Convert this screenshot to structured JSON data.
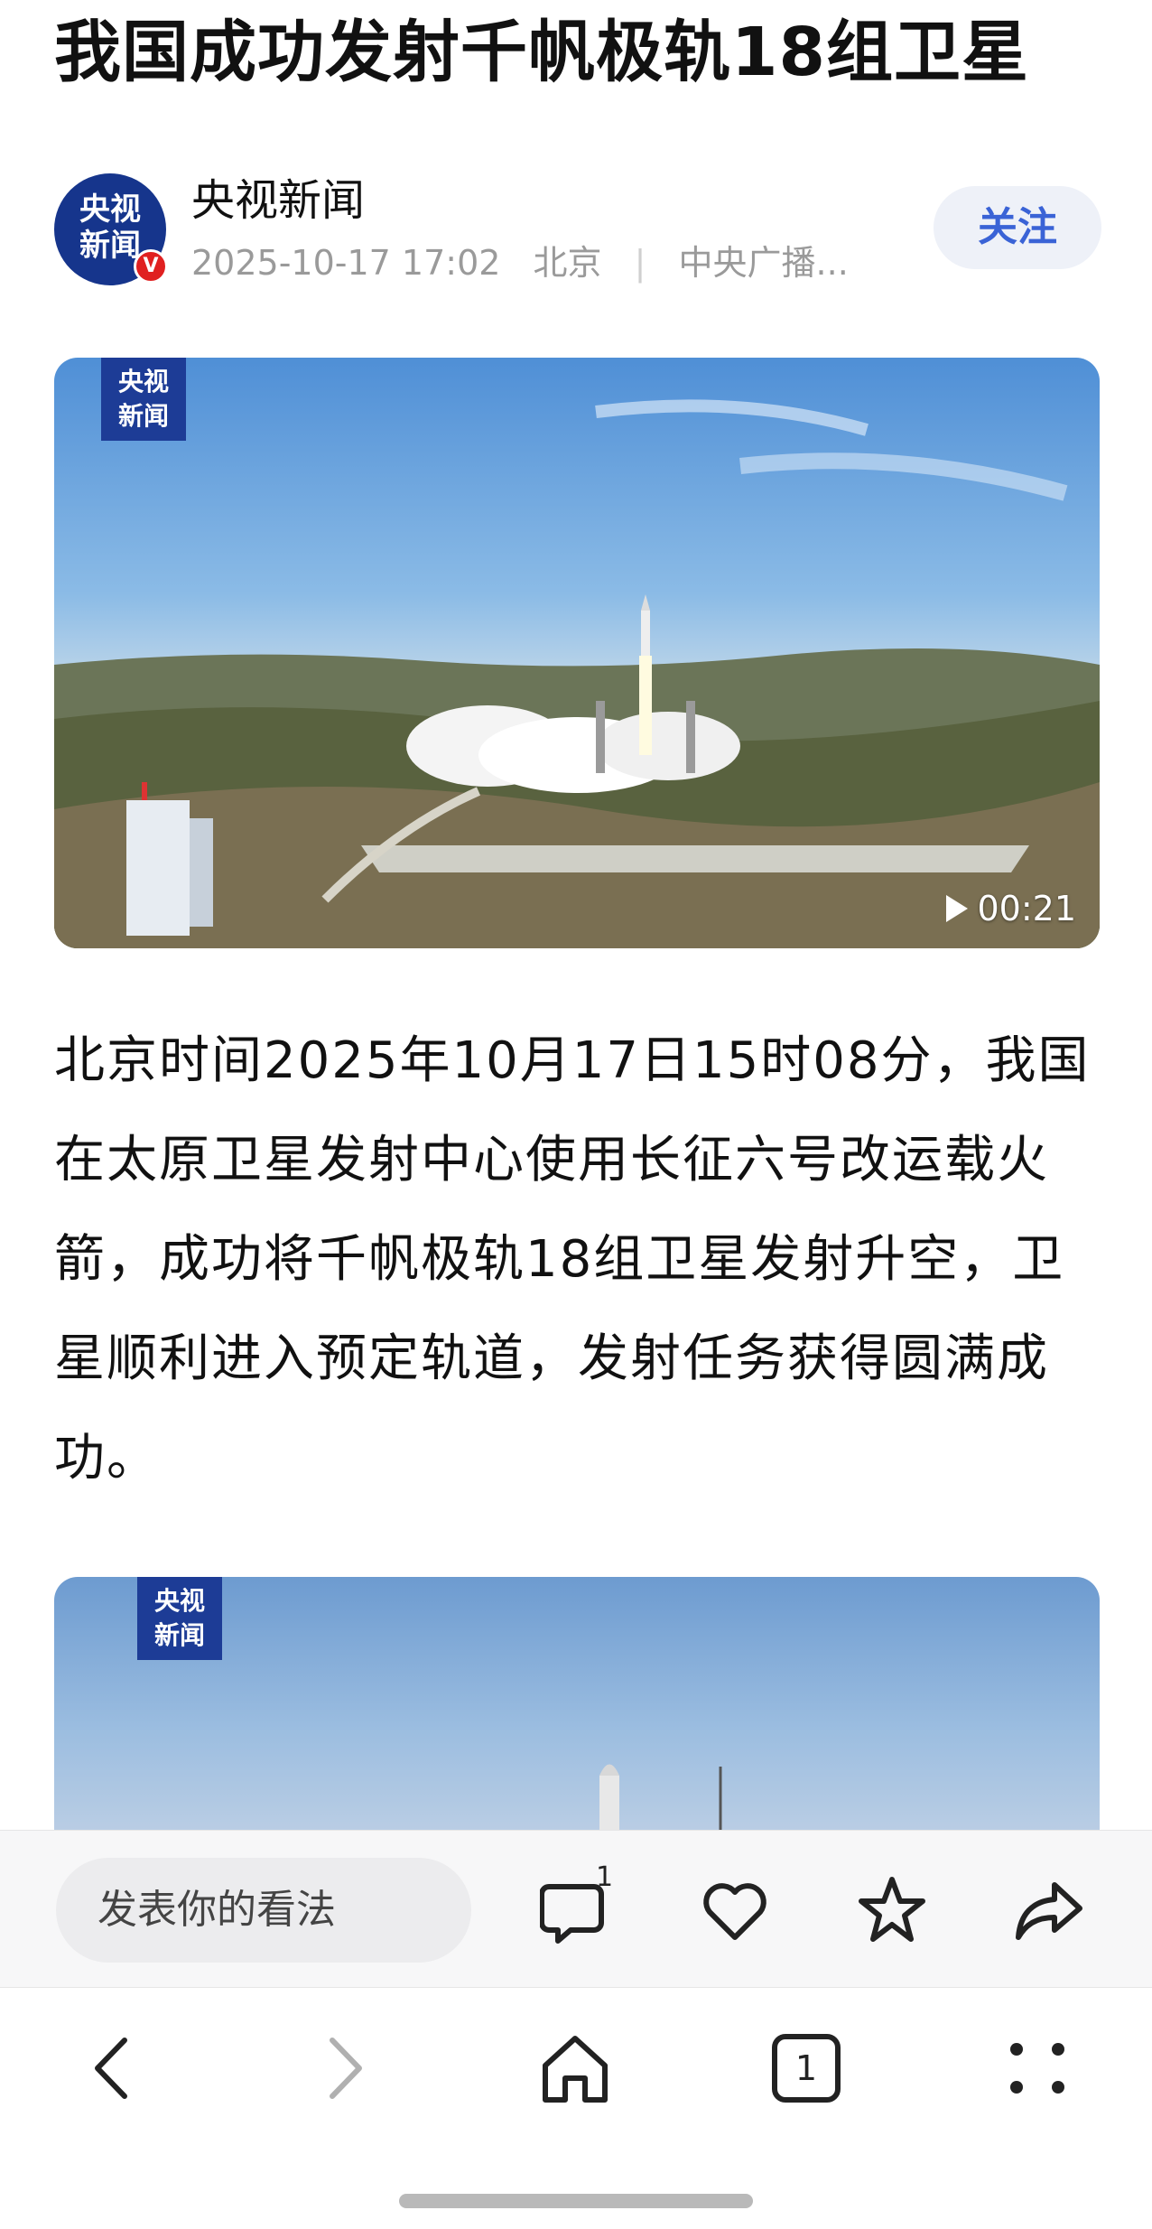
{
  "article": {
    "title": "我国成功发射千帆极轨18组卫星",
    "author": {
      "avatar_line1": "央视",
      "avatar_line2": "新闻",
      "verified_mark": "V",
      "name": "央视新闻",
      "datetime": "2025-10-17 17:02",
      "location": "北京",
      "source": "中央广播..."
    },
    "follow_label": "关注",
    "media1": {
      "mark_line1": "央视",
      "mark_line2": "新闻",
      "duration": "00:21"
    },
    "paragraph": "北京时间2025年10月17日15时08分，我国在太原卫星发射中心使用长征六号改运载火箭，成功将千帆极轨18组卫星发射升空，卫星顺利进入预定轨道，发射任务获得圆满成功。",
    "media2": {
      "mark_line1": "央视",
      "mark_line2": "新闻"
    }
  },
  "action_bar": {
    "comment_placeholder": "发表你的看法",
    "comment_count": "1",
    "icons": [
      "comment-icon",
      "like-icon",
      "favorite-icon",
      "share-icon"
    ]
  },
  "browser_nav": {
    "tab_count": "1",
    "icons": [
      "back-icon",
      "forward-icon",
      "home-icon",
      "tabs-icon",
      "menu-icon"
    ]
  },
  "colors": {
    "accent": "#3a63d6",
    "brand_blue": "#1d3c96",
    "verified_red": "#e02020"
  }
}
